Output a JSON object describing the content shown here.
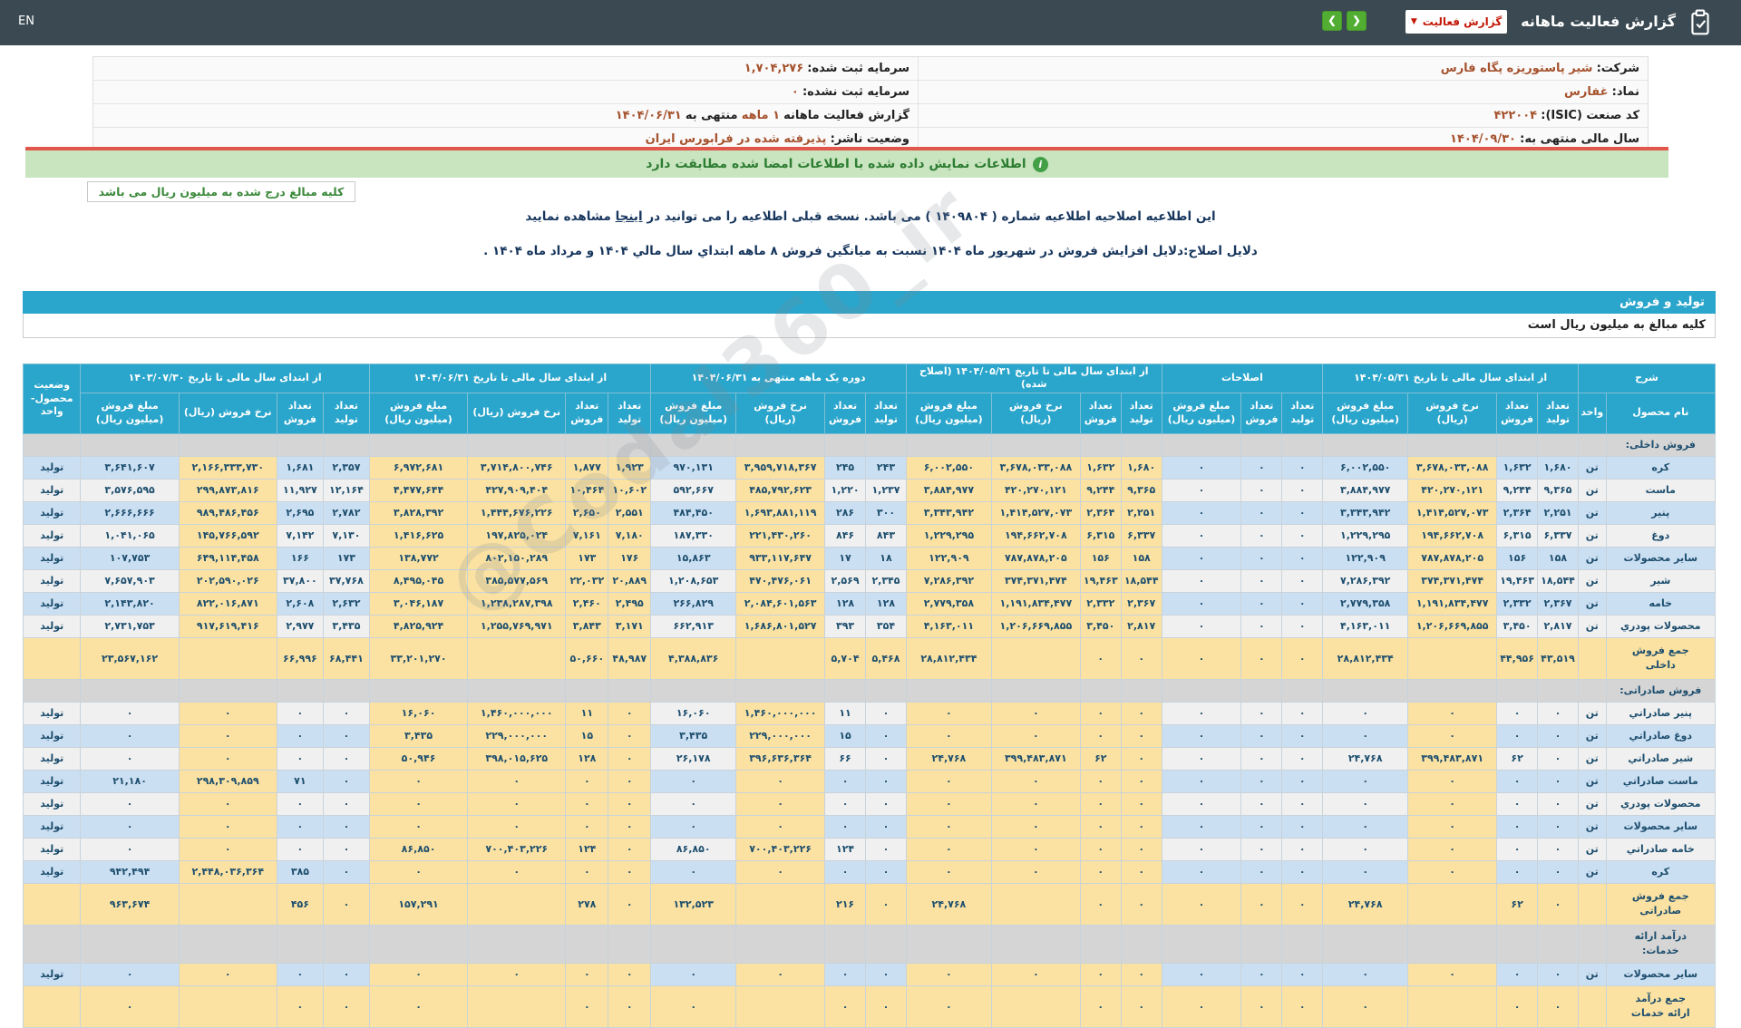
{
  "chrome": {
    "en_label": "EN",
    "title": "گزارش فعالیت ماهانه",
    "dropdown_label": "گزارش فعالیت",
    "nav_prev": "❮",
    "nav_next": "❯"
  },
  "info": {
    "rows": [
      {
        "right": {
          "label": "شرکت:",
          "value": "شیر پاستوریزه پگاه فارس"
        },
        "left": {
          "parts": [
            {
              "t": "سرمایه ثبت شده:",
              "k": "l"
            },
            {
              "t": "1,704,276",
              "k": "v"
            }
          ]
        }
      },
      {
        "right": {
          "label": "نماد:",
          "value": "غفارس"
        },
        "left": {
          "parts": [
            {
              "t": "سرمایه ثبت نشده:",
              "k": "l"
            },
            {
              "t": "0",
              "k": "v"
            }
          ]
        }
      },
      {
        "right": {
          "label": "کد صنعت (ISIC):",
          "value": "422004"
        },
        "left": {
          "parts": [
            {
              "t": "گزارش فعالیت ماهانه",
              "k": "l"
            },
            {
              "t": "1 ماهه",
              "k": "v"
            },
            {
              "t": "منتهی به",
              "k": "l"
            },
            {
              "t": "1404/06/31",
              "k": "v"
            }
          ]
        }
      },
      {
        "right": {
          "label": "سال مالی منتهی به:",
          "value": "1404/09/30"
        },
        "left": {
          "parts": [
            {
              "t": "وضعیت ناشر:",
              "k": "l"
            },
            {
              "t": "پذیرفته شده در فرابورس ایران",
              "k": "v"
            }
          ]
        }
      }
    ]
  },
  "banner": {
    "text": "اطلاعات نمایش داده شده با اطلاعات امضا شده مطابقت دارد"
  },
  "notes": {
    "amounts_box": "کلیه مبالغ درج شده به میلیون ریال می باشد",
    "amendment_pre": "این اطلاعیه اصلاحیه اطلاعیه شماره ( 1409804 ) می باشد. نسخه قبلی اطلاعیه را می توانید در",
    "amendment_link": "اینجا",
    "amendment_post": "مشاهده نمایید",
    "reason": "دلایل اصلاح:دلایل افزایش فروش در شهریور ماه 1404 نسبت به میانگین فروش 8 ماهه ابتداي سال مالي 1404 و مرداد ماه 1404 ."
  },
  "watermark": "@Codal360_ir",
  "production_table": {
    "title": "تولید و فروش",
    "unit_note": "کلیه مبالغ به میلیون ریال است",
    "groups": [
      {
        "label": "شرح",
        "cols": [
          "نام محصول",
          "واحد"
        ]
      },
      {
        "label": "از ابتدای سال مالی تا تاریخ ۱۴۰۴/۰۵/۳۱",
        "cols": [
          "تعداد تولید",
          "تعداد فروش",
          "نرخ فروش (ریال)",
          "مبلغ فروش (میلیون ریال)"
        ]
      },
      {
        "label": "اصلاحات",
        "cols": [
          "تعداد تولید",
          "تعداد فروش",
          "مبلغ فروش (میلیون ریال)"
        ]
      },
      {
        "label": "از ابتدای سال مالی تا تاریخ ۱۴۰۴/۰۵/۳۱ (اصلاح شده)",
        "cols": [
          "تعداد تولید",
          "تعداد فروش",
          "نرخ فروش (ریال)",
          "مبلغ فروش (میلیون ریال)"
        ]
      },
      {
        "label": "دوره یک ماهه منتهی به ۱۴۰۴/۰۶/۳۱",
        "cols": [
          "تعداد تولید",
          "تعداد فروش",
          "نرخ فروش (ریال)",
          "مبلغ فروش (میلیون ریال)"
        ]
      },
      {
        "label": "از ابتدای سال مالی تا تاریخ ۱۴۰۴/۰۶/۳۱",
        "cols": [
          "تعداد تولید",
          "تعداد فروش",
          "نرخ فروش (ریال)",
          "مبلغ فروش (میلیون ریال)"
        ]
      },
      {
        "label": "از ابتدای سال مالی تا تاریخ ۱۴۰۳/۰۷/۳۰",
        "cols": [
          "تعداد تولید",
          "تعداد فروش",
          "نرخ فروش (ریال)",
          "مبلغ فروش (میلیون ریال)"
        ]
      },
      {
        "label": "وضعیت محصول-واحد",
        "cols": []
      }
    ],
    "rows": [
      {
        "type": "section",
        "name": "فروش داخلی:"
      },
      {
        "type": "item",
        "stripe": "b",
        "name": "کره",
        "unit": "تن",
        "g1": [
          "1,680",
          "1,632",
          "3,678,033,088",
          "6,002,550"
        ],
        "adj": [
          "0",
          "0",
          "0"
        ],
        "g2": [
          "1,680",
          "1,632",
          "3,678,033,088",
          "6,002,550"
        ],
        "g3": [
          "243",
          "245",
          "3,959,718,367",
          "970,131"
        ],
        "g4": [
          "1,923",
          "1,877",
          "3,714,800,746",
          "6,972,681"
        ],
        "g5": [
          "2,357",
          "1,681",
          "2,166,333,730",
          "3,641,607"
        ],
        "status": "تولید"
      },
      {
        "type": "item",
        "stripe": "w",
        "name": "ماست",
        "unit": "تن",
        "g1": [
          "9,365",
          "9,244",
          "420,270,121",
          "3,884,977"
        ],
        "adj": [
          "0",
          "0",
          "0"
        ],
        "g2": [
          "9,365",
          "9,244",
          "420,270,121",
          "3,884,977"
        ],
        "g3": [
          "1,237",
          "1,220",
          "485,792,623",
          "592,667"
        ],
        "g4": [
          "10,602",
          "10,464",
          "427,909,404",
          "4,477,644"
        ],
        "g5": [
          "12,164",
          "11,927",
          "299,873,816",
          "3,576,595"
        ],
        "status": "تولید"
      },
      {
        "type": "item",
        "stripe": "b",
        "name": "پنیر",
        "unit": "تن",
        "g1": [
          "2,251",
          "2,364",
          "1,414,527,073",
          "3,343,942"
        ],
        "adj": [
          "0",
          "0",
          "0"
        ],
        "g2": [
          "2,251",
          "2,364",
          "1,414,527,073",
          "3,343,942"
        ],
        "g3": [
          "300",
          "286",
          "1,693,881,119",
          "484,450"
        ],
        "g4": [
          "2,551",
          "2,650",
          "1,444,676,226",
          "3,828,392"
        ],
        "g5": [
          "2,782",
          "2,695",
          "989,486,456",
          "2,666,666"
        ],
        "status": "تولید"
      },
      {
        "type": "item",
        "stripe": "w",
        "name": "دوغ",
        "unit": "تن",
        "g1": [
          "6,337",
          "6,315",
          "194,662,708",
          "1,229,295"
        ],
        "adj": [
          "0",
          "0",
          "0"
        ],
        "g2": [
          "6,337",
          "6,315",
          "194,662,708",
          "1,229,295"
        ],
        "g3": [
          "843",
          "846",
          "221,430,260",
          "187,330"
        ],
        "g4": [
          "7,180",
          "7,161",
          "197,825,024",
          "1,416,625"
        ],
        "g5": [
          "7,130",
          "7,142",
          "145,766,592",
          "1,041,065"
        ],
        "status": "تولید"
      },
      {
        "type": "item",
        "stripe": "b",
        "name": "سایر محصولات",
        "unit": "تن",
        "g1": [
          "158",
          "156",
          "787,878,205",
          "122,909"
        ],
        "adj": [
          "0",
          "0",
          "0"
        ],
        "g2": [
          "158",
          "156",
          "787,878,205",
          "122,909"
        ],
        "g3": [
          "18",
          "17",
          "933,117,647",
          "15,863"
        ],
        "g4": [
          "176",
          "173",
          "802,150,289",
          "138,772"
        ],
        "g5": [
          "173",
          "166",
          "649,114,458",
          "107,753"
        ],
        "status": "تولید"
      },
      {
        "type": "item",
        "stripe": "w",
        "name": "شیر",
        "unit": "تن",
        "g1": [
          "18,544",
          "19,463",
          "374,371,474",
          "7,286,392"
        ],
        "adj": [
          "0",
          "0",
          "0"
        ],
        "g2": [
          "18,544",
          "19,463",
          "374,371,474",
          "7,286,392"
        ],
        "g3": [
          "2,345",
          "2,569",
          "470,476,061",
          "1,208,653"
        ],
        "g4": [
          "20,889",
          "22,032",
          "385,577,569",
          "8,495,045"
        ],
        "g5": [
          "37,768",
          "37,800",
          "202,590,026",
          "7,657,903"
        ],
        "status": "تولید"
      },
      {
        "type": "item",
        "stripe": "b",
        "name": "خامه",
        "unit": "تن",
        "g1": [
          "2,367",
          "2,332",
          "1,191,834,477",
          "2,779,358"
        ],
        "adj": [
          "0",
          "0",
          "0"
        ],
        "g2": [
          "2,367",
          "2,332",
          "1,191,834,477",
          "2,779,358"
        ],
        "g3": [
          "128",
          "128",
          "2,084,601,563",
          "266,829"
        ],
        "g4": [
          "2,495",
          "2,460",
          "1,238,287,398",
          "3,046,187"
        ],
        "g5": [
          "2,632",
          "2,608",
          "822,016,871",
          "2,143,820"
        ],
        "status": "تولید"
      },
      {
        "type": "item",
        "stripe": "w",
        "name": "محصولات پودري",
        "unit": "تن",
        "g1": [
          "2,817",
          "3,450",
          "1,206,669,855",
          "4,163,011"
        ],
        "adj": [
          "0",
          "0",
          "0"
        ],
        "g2": [
          "2,817",
          "3,450",
          "1,206,669,855",
          "4,163,011"
        ],
        "g3": [
          "354",
          "393",
          "1,686,801,527",
          "662,913"
        ],
        "g4": [
          "3,171",
          "3,843",
          "1,255,769,971",
          "4,825,924"
        ],
        "g5": [
          "3,435",
          "2,977",
          "917,619,416",
          "2,731,753"
        ],
        "status": "تولید"
      },
      {
        "type": "total",
        "name": "جمع فروش داخلی",
        "unit": "",
        "g1": [
          "43,519",
          "44,956",
          "",
          "28,812,434"
        ],
        "adj": [
          "0",
          "0",
          "0"
        ],
        "g2": [
          "0",
          "0",
          "",
          "28,812,434"
        ],
        "g3": [
          "5,468",
          "5,704",
          "",
          "4,388,836"
        ],
        "g4": [
          "48,987",
          "50,660",
          "",
          "33,201,270"
        ],
        "g5": [
          "68,441",
          "66,996",
          "",
          "23,567,162"
        ],
        "status": ""
      },
      {
        "type": "section",
        "name": "فروش صادراتی:"
      },
      {
        "type": "item",
        "stripe": "w",
        "name": "پنیر صادراتي",
        "unit": "تن",
        "g1": [
          "0",
          "0",
          "0",
          "0"
        ],
        "adj": [
          "0",
          "0",
          "0"
        ],
        "g2": [
          "0",
          "0",
          "0",
          "0"
        ],
        "g3": [
          "0",
          "11",
          "1,460,000,000",
          "16,060"
        ],
        "g4": [
          "0",
          "11",
          "1,460,000,000",
          "16,060"
        ],
        "g5": [
          "0",
          "0",
          "0",
          "0"
        ],
        "status": "تولید"
      },
      {
        "type": "item",
        "stripe": "b",
        "name": "دوغ صادراتي",
        "unit": "تن",
        "g1": [
          "0",
          "0",
          "0",
          "0"
        ],
        "adj": [
          "0",
          "0",
          "0"
        ],
        "g2": [
          "0",
          "0",
          "0",
          "0"
        ],
        "g3": [
          "0",
          "15",
          "229,000,000",
          "3,435"
        ],
        "g4": [
          "0",
          "15",
          "229,000,000",
          "3,435"
        ],
        "g5": [
          "0",
          "0",
          "0",
          "0"
        ],
        "status": "تولید"
      },
      {
        "type": "item",
        "stripe": "w",
        "name": "شیر صادراتي",
        "unit": "تن",
        "g1": [
          "0",
          "62",
          "399,483,871",
          "24,768"
        ],
        "adj": [
          "0",
          "0",
          "0"
        ],
        "g2": [
          "0",
          "62",
          "399,483,871",
          "24,768"
        ],
        "g3": [
          "0",
          "66",
          "396,636,364",
          "26,178"
        ],
        "g4": [
          "0",
          "128",
          "398,015,625",
          "50,946"
        ],
        "g5": [
          "0",
          "0",
          "0",
          "0"
        ],
        "status": "تولید"
      },
      {
        "type": "item",
        "stripe": "b",
        "name": "ماست صادراتي",
        "unit": "تن",
        "g1": [
          "0",
          "0",
          "0",
          "0"
        ],
        "adj": [
          "0",
          "0",
          "0"
        ],
        "g2": [
          "0",
          "0",
          "0",
          "0"
        ],
        "g3": [
          "0",
          "0",
          "0",
          "0"
        ],
        "g4": [
          "0",
          "0",
          "0",
          "0"
        ],
        "g5": [
          "0",
          "71",
          "298,309,859",
          "21,180"
        ],
        "status": "تولید"
      },
      {
        "type": "item",
        "stripe": "w",
        "name": "محصولات پودري",
        "unit": "تن",
        "g1": [
          "0",
          "0",
          "0",
          "0"
        ],
        "adj": [
          "0",
          "0",
          "0"
        ],
        "g2": [
          "0",
          "0",
          "0",
          "0"
        ],
        "g3": [
          "0",
          "0",
          "0",
          "0"
        ],
        "g4": [
          "0",
          "0",
          "0",
          "0"
        ],
        "g5": [
          "0",
          "0",
          "0",
          "0"
        ],
        "status": "تولید"
      },
      {
        "type": "item",
        "stripe": "b",
        "name": "سایر محصولات",
        "unit": "تن",
        "g1": [
          "0",
          "0",
          "0",
          "0"
        ],
        "adj": [
          "0",
          "0",
          "0"
        ],
        "g2": [
          "0",
          "0",
          "0",
          "0"
        ],
        "g3": [
          "0",
          "0",
          "0",
          "0"
        ],
        "g4": [
          "0",
          "0",
          "0",
          "0"
        ],
        "g5": [
          "0",
          "0",
          "0",
          "0"
        ],
        "status": "تولید"
      },
      {
        "type": "item",
        "stripe": "w",
        "name": "خامه صادراتي",
        "unit": "تن",
        "g1": [
          "0",
          "0",
          "0",
          "0"
        ],
        "adj": [
          "0",
          "0",
          "0"
        ],
        "g2": [
          "0",
          "0",
          "0",
          "0"
        ],
        "g3": [
          "0",
          "124",
          "700,403,226",
          "86,850"
        ],
        "g4": [
          "0",
          "124",
          "700,403,226",
          "86,850"
        ],
        "g5": [
          "0",
          "0",
          "0",
          "0"
        ],
        "status": "تولید"
      },
      {
        "type": "item",
        "stripe": "b",
        "name": "کره",
        "unit": "تن",
        "g1": [
          "0",
          "0",
          "0",
          "0"
        ],
        "adj": [
          "0",
          "0",
          "0"
        ],
        "g2": [
          "0",
          "0",
          "0",
          "0"
        ],
        "g3": [
          "0",
          "0",
          "0",
          "0"
        ],
        "g4": [
          "0",
          "0",
          "0",
          "0"
        ],
        "g5": [
          "0",
          "385",
          "2,448,036,364",
          "942,494"
        ],
        "status": "تولید"
      },
      {
        "type": "total",
        "name": "جمع فروش صادراتی",
        "unit": "",
        "g1": [
          "0",
          "62",
          "",
          "24,768"
        ],
        "adj": [
          "0",
          "0",
          "0"
        ],
        "g2": [
          "0",
          "0",
          "",
          "24,768"
        ],
        "g3": [
          "0",
          "216",
          "",
          "132,523"
        ],
        "g4": [
          "0",
          "278",
          "",
          "157,291"
        ],
        "g5": [
          "0",
          "456",
          "",
          "963,674"
        ],
        "status": ""
      },
      {
        "type": "section",
        "name": "درآمد ارائه خدمات:",
        "tall": true
      },
      {
        "type": "item",
        "stripe": "b",
        "name": "سایر محصولات",
        "unit": "تن",
        "g1": [
          "0",
          "0",
          "0",
          "0"
        ],
        "adj": [
          "0",
          "0",
          "0"
        ],
        "g2": [
          "0",
          "0",
          "0",
          "0"
        ],
        "g3": [
          "0",
          "0",
          "0",
          "0"
        ],
        "g4": [
          "0",
          "0",
          "0",
          "0"
        ],
        "g5": [
          "0",
          "0",
          "0",
          "0"
        ],
        "status": "تولید"
      },
      {
        "type": "total",
        "name": "جمع درآمد ارائه خدمات",
        "unit": "",
        "g1": [
          "0",
          "0",
          "",
          "0"
        ],
        "adj": [
          "0",
          "0",
          "0"
        ],
        "g2": [
          "0",
          "0",
          "",
          "0"
        ],
        "g3": [
          "0",
          "0",
          "",
          "0"
        ],
        "g4": [
          "0",
          "0",
          "",
          "0"
        ],
        "g5": [
          "0",
          "0",
          "",
          "0"
        ],
        "status": ""
      }
    ]
  }
}
